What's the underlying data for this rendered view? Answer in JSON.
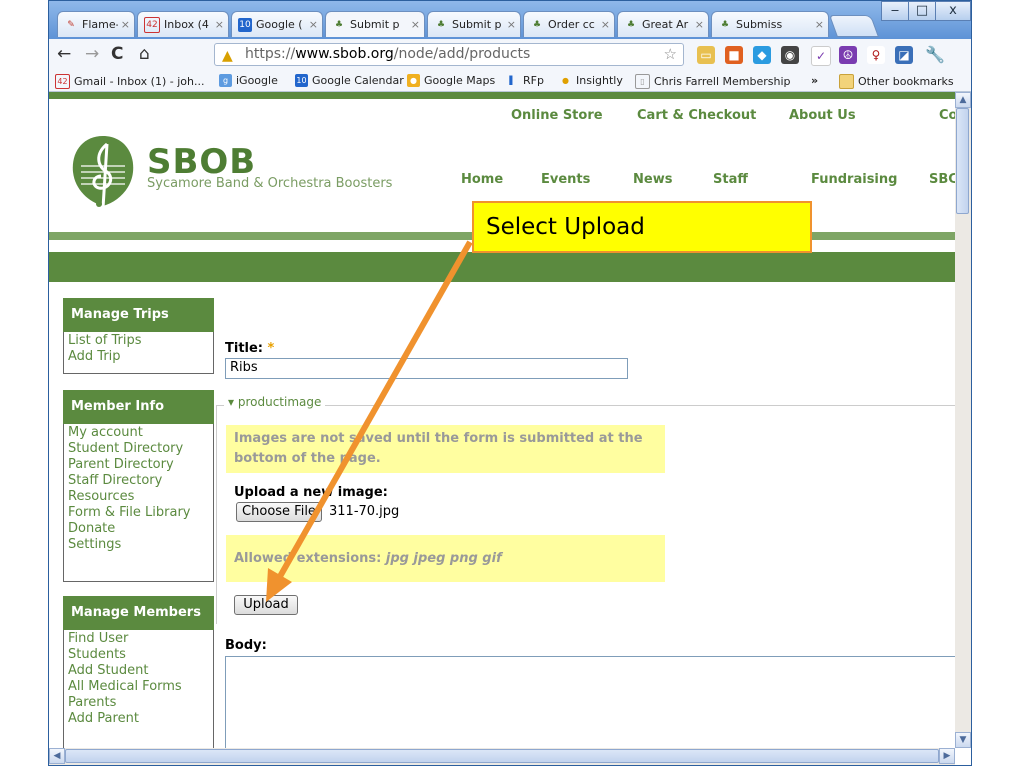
{
  "browser": {
    "tabs": [
      {
        "title": "Flame-R",
        "icon": "flame-icon",
        "active": false
      },
      {
        "title": "Inbox (4",
        "icon": "gmail-icon",
        "active": false
      },
      {
        "title": "Google (",
        "icon": "google-calendar-icon",
        "active": false
      },
      {
        "title": "Submit p",
        "icon": "sbob-icon",
        "active": true
      },
      {
        "title": "Submit p",
        "icon": "sbob-icon",
        "active": false
      },
      {
        "title": "Order cc",
        "icon": "sbob-icon",
        "active": false
      },
      {
        "title": "Great Ar",
        "icon": "sbob-icon",
        "active": false
      },
      {
        "title": "Submiss",
        "icon": "sbob-icon",
        "active": false
      }
    ],
    "tab_close": "×",
    "window_controls": {
      "minimize": "‒",
      "maximize": "□",
      "close": "x"
    },
    "address": {
      "scheme": "https://",
      "host": "www.sbob.org",
      "path": "/node/add/products"
    },
    "bookmarks": [
      {
        "label": "Gmail - Inbox (1) - joh...",
        "icon": "gmail-icon"
      },
      {
        "label": "iGoogle",
        "icon": "igoogle-icon"
      },
      {
        "label": "Google Calendar",
        "icon": "google-calendar-icon"
      },
      {
        "label": "Google Maps",
        "icon": "google-maps-icon"
      },
      {
        "label": "RFp",
        "icon": "rfp-icon"
      },
      {
        "label": "Insightly",
        "icon": "insightly-icon"
      },
      {
        "label": "Chris Farrell Membership",
        "icon": "page-icon"
      }
    ],
    "bookmarks_overflow": "»",
    "other_bookmarks": "Other bookmarks",
    "calendar_badge": "10",
    "gmail_badge": "42"
  },
  "site": {
    "name": "SBOB",
    "slogan": "Sycamore Band & Orchestra Boosters",
    "top_nav": [
      "Online Store",
      "Cart & Checkout",
      "About Us",
      "Co"
    ],
    "main_nav": [
      "Home",
      "Events",
      "News",
      "Staff",
      "Fundraising",
      "SBC"
    ]
  },
  "sidebar": {
    "blocks": [
      {
        "title": "Manage Trips",
        "items": [
          "List of Trips",
          "Add Trip"
        ]
      },
      {
        "title": "Member Info",
        "items": [
          "My account",
          "Student Directory",
          "Parent Directory",
          "Staff Directory",
          "Resources",
          "Form & File Library",
          "Donate",
          "Settings"
        ]
      },
      {
        "title": "Manage Members",
        "items": [
          "Find User",
          "Students",
          "Add Student",
          "All Medical Forms",
          "Parents",
          "Add Parent"
        ]
      }
    ]
  },
  "form": {
    "title_label": "Title:",
    "required_mark": "*",
    "title_value": "Ribs",
    "fieldset_legend": "productimage",
    "notice": "Images are not saved until the form is submitted at the bottom of the page.",
    "upload_label": "Upload a new image:",
    "choose_file_button": "Choose File",
    "chosen_file": "311-70.jpg",
    "allowed_label": "Allowed extensions:",
    "allowed_extensions": "jpg jpeg png gif",
    "upload_button": "Upload",
    "body_label": "Body:"
  },
  "annotation": {
    "callout_text": "Select Upload",
    "colors": {
      "fill": "#ffff00",
      "border": "#f0922e",
      "arrow": "#f0922e"
    }
  },
  "colors": {
    "site_green": "#5b8a3f",
    "chrome_blue": "#4f8bd6",
    "notice_yellow": "#fffea0"
  }
}
